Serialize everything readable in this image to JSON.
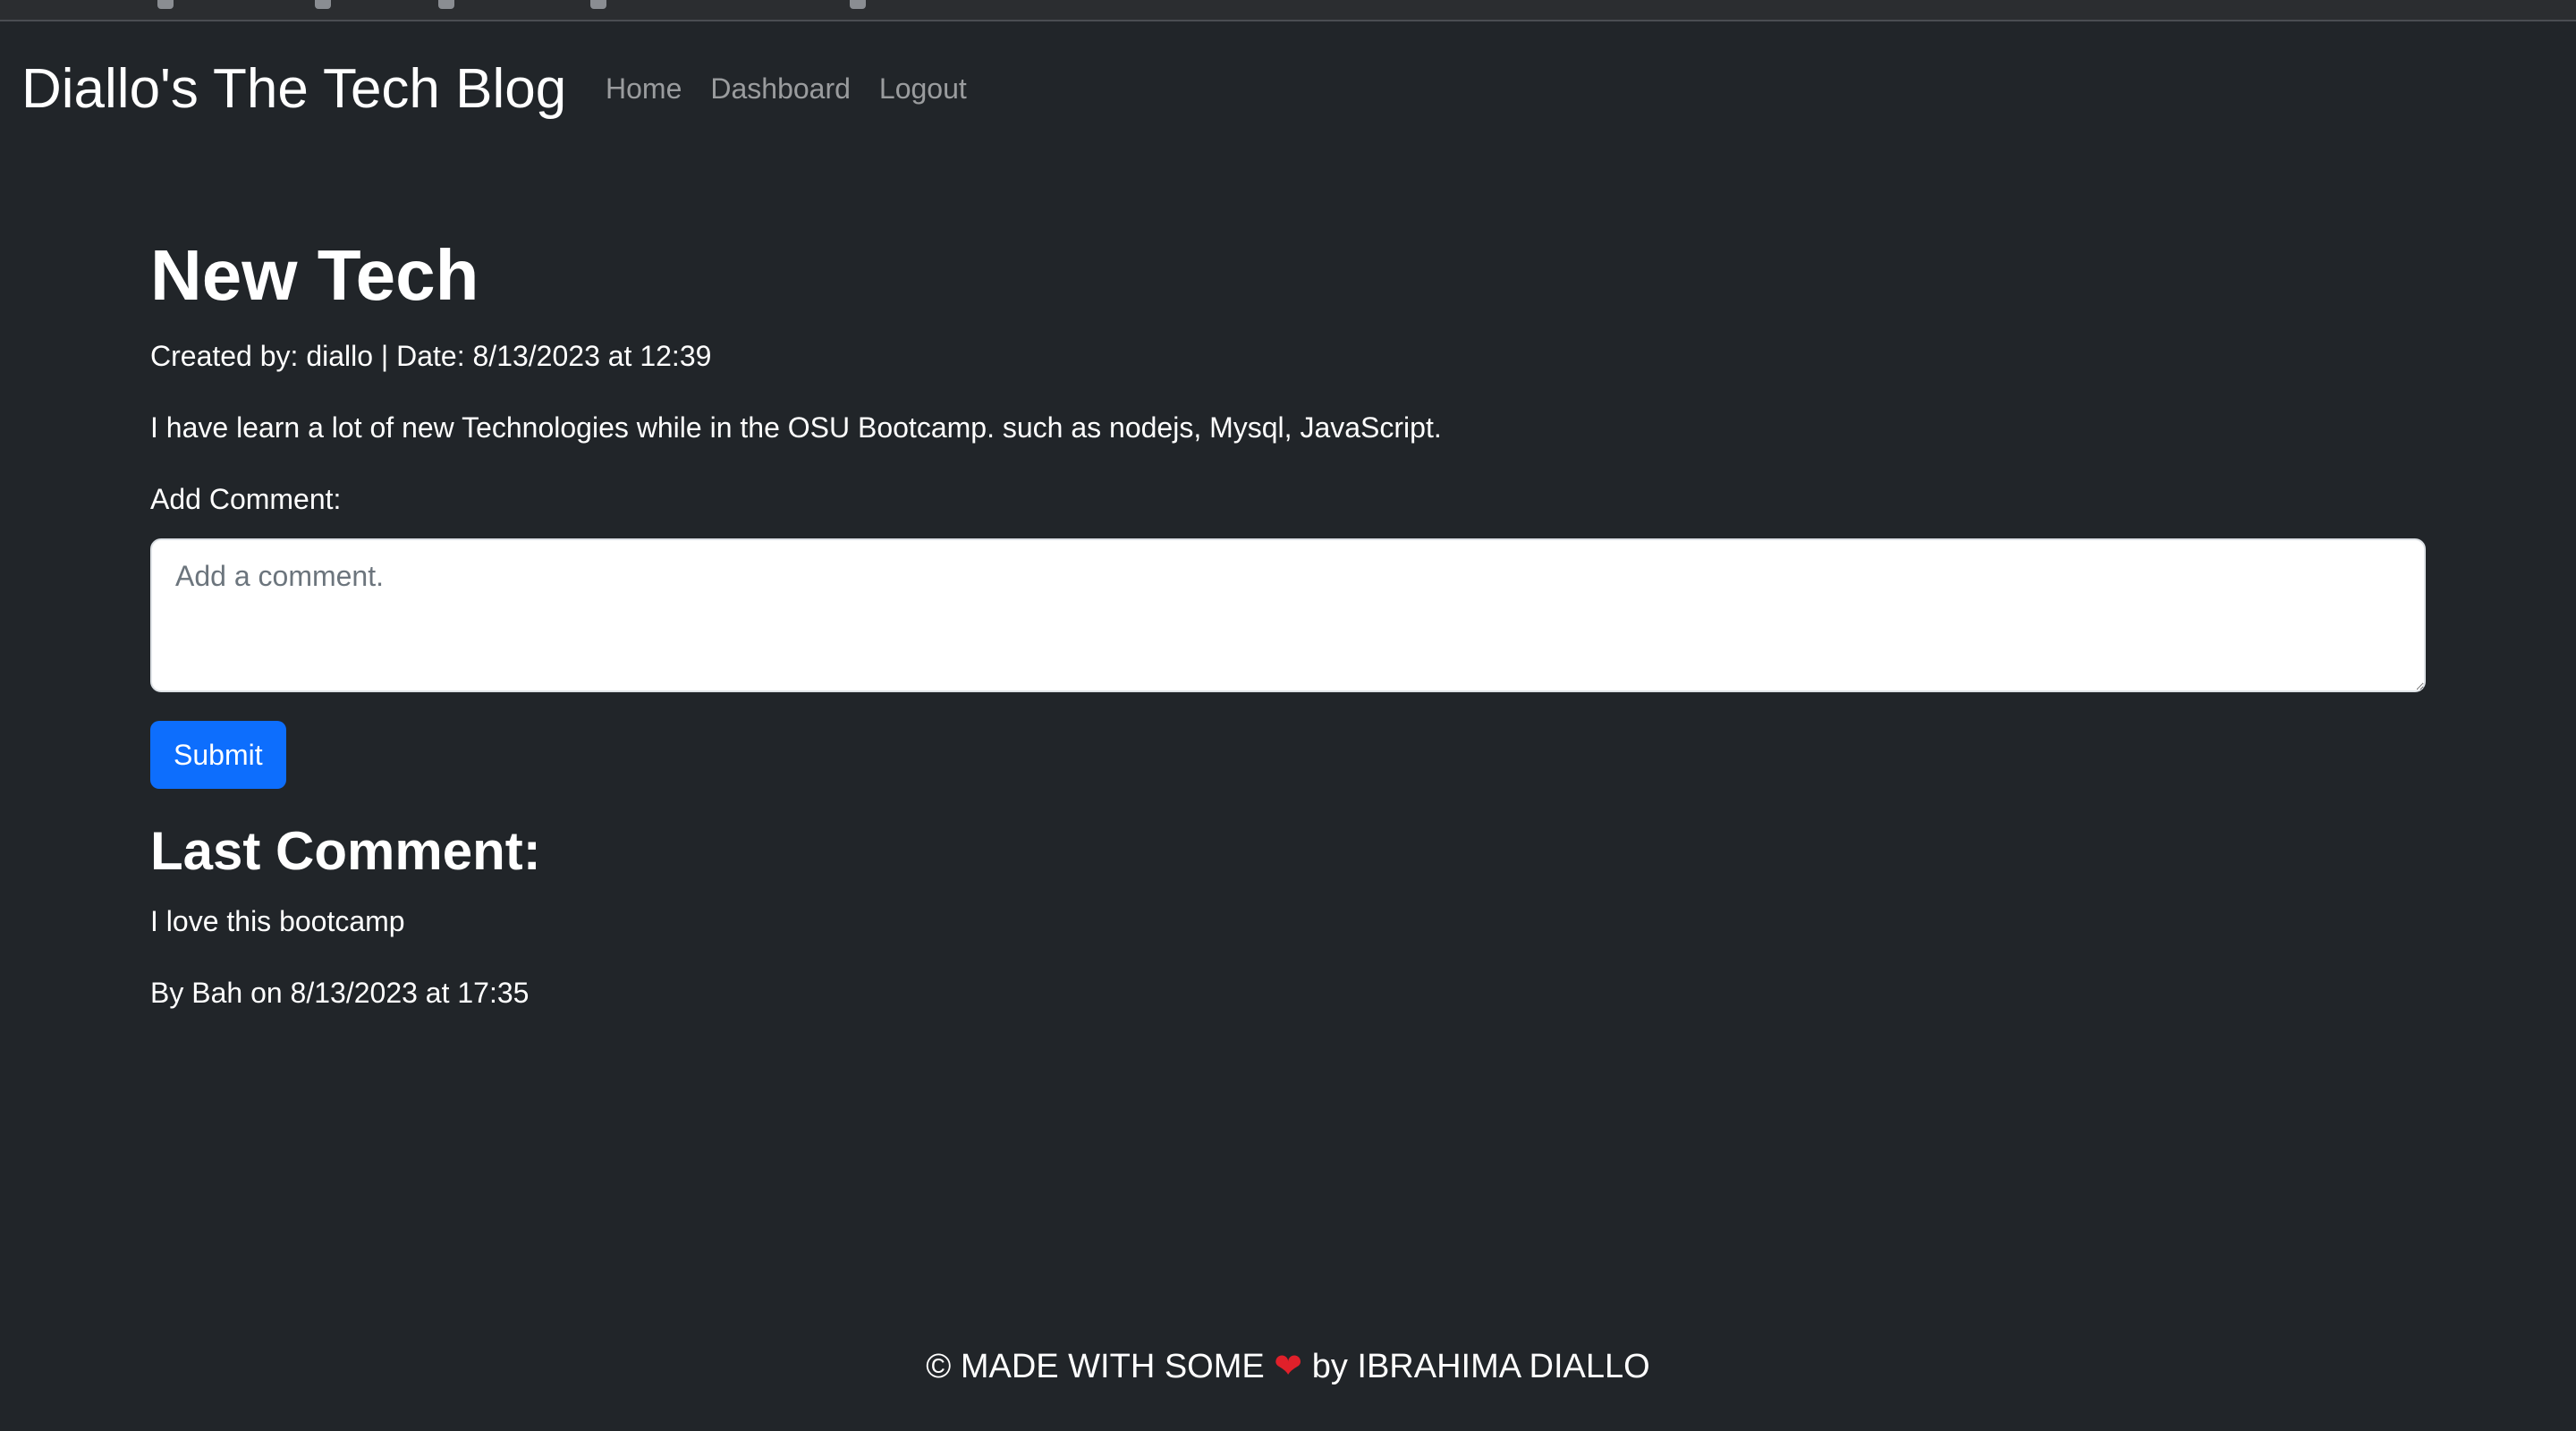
{
  "header": {
    "brand": "Diallo's The Tech Blog",
    "nav": [
      {
        "label": "Home"
      },
      {
        "label": "Dashboard"
      },
      {
        "label": "Logout"
      }
    ]
  },
  "post": {
    "title": "New Tech",
    "meta": "Created by: diallo | Date: 8/13/2023 at 12:39",
    "body": "I have learn a lot of new Technologies while in the OSU Bootcamp. such as nodejs, Mysql, JavaScript."
  },
  "comment_form": {
    "label": "Add Comment:",
    "placeholder": "Add a comment.",
    "value": "",
    "submit_label": "Submit"
  },
  "last_comment": {
    "heading": "Last Comment:",
    "text": "I love this bootcamp",
    "byline": "By Bah on 8/13/2023 at 17:35"
  },
  "footer": {
    "prefix": "© MADE WITH SOME",
    "heart": "❤",
    "suffix": "by IBRAHIMA DIALLO"
  },
  "colors": {
    "background": "#212529",
    "primary_button": "#0d6efd",
    "nav_link": "rgba(255,255,255,0.55)",
    "heart": "#e0202a"
  }
}
